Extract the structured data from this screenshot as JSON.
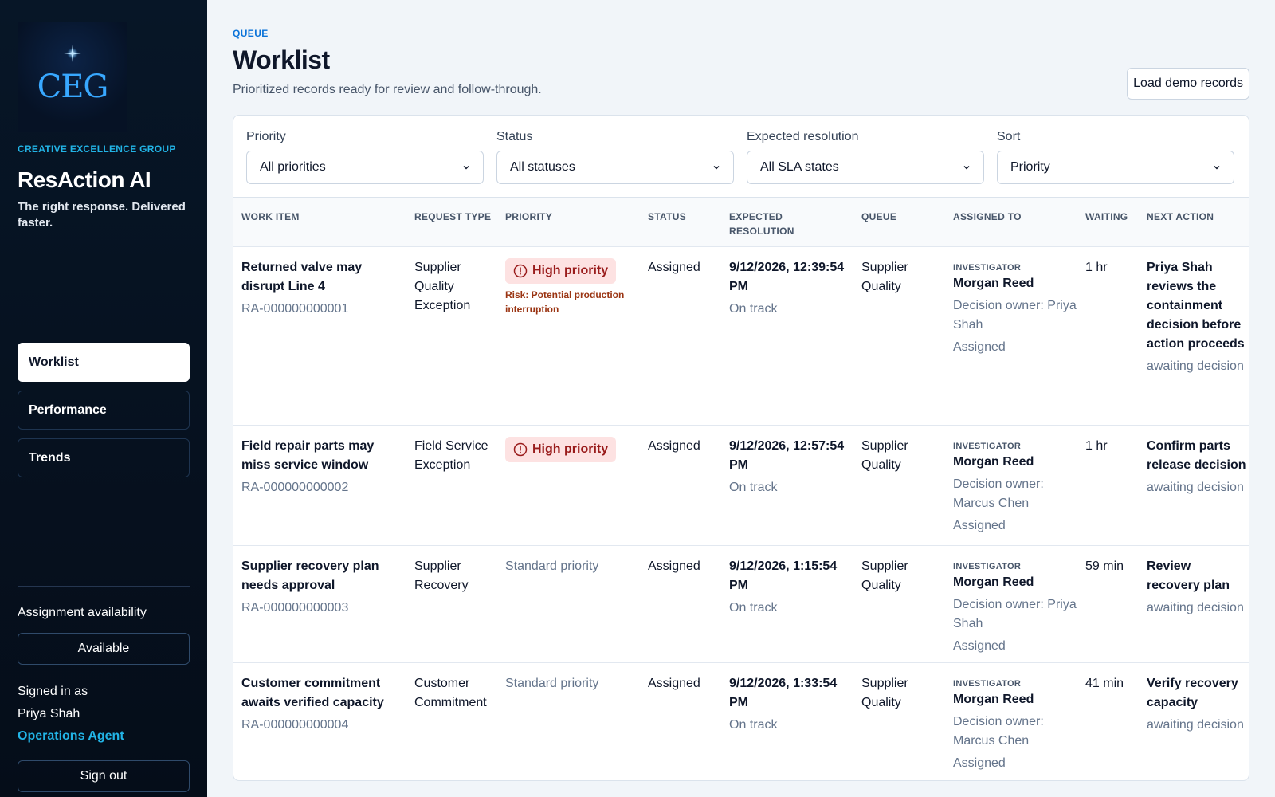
{
  "sidebar": {
    "logo_text": "CEG",
    "org": "CREATIVE EXCELLENCE GROUP",
    "app_name": "ResAction AI",
    "tagline": "The right response. Delivered faster.",
    "nav": [
      {
        "label": "Worklist",
        "active": true
      },
      {
        "label": "Performance",
        "active": false
      },
      {
        "label": "Trends",
        "active": false
      }
    ],
    "availability_label": "Assignment availability",
    "availability_value": "Available",
    "signed_in_label": "Signed in as",
    "user_name": "Priya Shah",
    "user_role": "Operations Agent",
    "sign_out": "Sign out"
  },
  "header": {
    "eyebrow": "QUEUE",
    "title": "Worklist",
    "subtitle": "Prioritized records ready for review and follow-through.",
    "load_button": "Load demo records"
  },
  "filters": [
    {
      "label": "Priority",
      "value": "All priorities"
    },
    {
      "label": "Status",
      "value": "All statuses"
    },
    {
      "label": "Expected resolution",
      "value": "All SLA states"
    },
    {
      "label": "Sort",
      "value": "Priority"
    }
  ],
  "table": {
    "headers": {
      "work_item": "WORK ITEM",
      "request_type": "REQUEST TYPE",
      "priority": "PRIORITY",
      "status": "STATUS",
      "expected_line1": "EXPECTED",
      "expected_line2": "RESOLUTION",
      "queue": "QUEUE",
      "assigned_to": "ASSIGNED TO",
      "waiting": "WAITING",
      "next_action": "NEXT ACTION"
    },
    "rows": [
      {
        "title": "Returned valve may disrupt Line 4",
        "id": "RA-000000000001",
        "request_type": "Supplier Quality Exception",
        "priority": "High priority",
        "risk": "Risk: Potential production interruption",
        "status": "Assigned",
        "expected": "9/12/2026, 12:39:54 PM",
        "sla": "On track",
        "queue": "Supplier Quality",
        "role": "INVESTIGATOR",
        "assignee": "Morgan Reed",
        "owner": "Decision owner: Priya Shah",
        "assign_status": "Assigned",
        "waiting": "1 hr",
        "next_action": "Priya Shah reviews the containment decision before action proceeds",
        "next_status": "awaiting decision"
      },
      {
        "title": "Field repair parts may miss service window",
        "id": "RA-000000000002",
        "request_type": "Field Service Exception",
        "priority": "High priority",
        "risk": "",
        "status": "Assigned",
        "expected": "9/12/2026, 12:57:54 PM",
        "sla": "On track",
        "queue": "Supplier Quality",
        "role": "INVESTIGATOR",
        "assignee": "Morgan Reed",
        "owner": "Decision owner: Marcus Chen",
        "assign_status": "Assigned",
        "waiting": "1 hr",
        "next_action": "Confirm parts release decision",
        "next_status": "awaiting decision"
      },
      {
        "title": "Supplier recovery plan needs approval",
        "id": "RA-000000000003",
        "request_type": "Supplier Recovery",
        "priority": "Standard priority",
        "risk": "",
        "status": "Assigned",
        "expected": "9/12/2026, 1:15:54 PM",
        "sla": "On track",
        "queue": "Supplier Quality",
        "role": "INVESTIGATOR",
        "assignee": "Morgan Reed",
        "owner": "Decision owner: Priya Shah",
        "assign_status": "Assigned",
        "waiting": "59 min",
        "next_action": "Review recovery plan",
        "next_status": "awaiting decision"
      },
      {
        "title": "Customer commitment awaits verified capacity",
        "id": "RA-000000000004",
        "request_type": "Customer Commitment",
        "priority": "Standard priority",
        "risk": "",
        "status": "Assigned",
        "expected": "9/12/2026, 1:33:54 PM",
        "sla": "On track",
        "queue": "Supplier Quality",
        "role": "INVESTIGATOR",
        "assignee": "Morgan Reed",
        "owner": "Decision owner: Marcus Chen",
        "assign_status": "Assigned",
        "waiting": "41 min",
        "next_action": "Verify recovery capacity",
        "next_status": "awaiting decision"
      }
    ]
  },
  "colors": {
    "sidebar_bg": "#061224",
    "accent": "#22b4e6",
    "high_priority_bg": "#fde2e2",
    "high_priority_text": "#991b1b"
  }
}
